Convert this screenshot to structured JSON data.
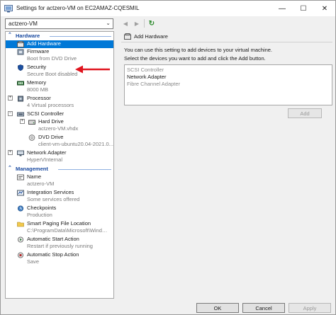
{
  "window": {
    "title": "Settings for actzero-VM on EC2AMAZ-CQESMIL",
    "minimize": "—",
    "maximize": "☐",
    "close": "✕"
  },
  "toolbar": {
    "vm_selected": "actzero-VM",
    "back_glyph": "◀",
    "forward_glyph": "▶",
    "refresh_glyph": "↻"
  },
  "tree": {
    "hardware_header": "Hardware",
    "management_header": "Management",
    "hardware": [
      {
        "label": "Add Hardware",
        "sub": "",
        "icon": "add-hardware-icon",
        "selected": true
      },
      {
        "label": "Firmware",
        "sub": "Boot from DVD Drive",
        "icon": "firmware-icon"
      },
      {
        "label": "Security",
        "sub": "Secure Boot disabled",
        "icon": "shield-icon"
      },
      {
        "label": "Memory",
        "sub": "8000 MB",
        "icon": "memory-icon"
      },
      {
        "label": "Processor",
        "sub": "4 Virtual processors",
        "icon": "processor-icon"
      },
      {
        "label": "SCSI Controller",
        "sub": "",
        "icon": "scsi-controller-icon"
      },
      {
        "label": "Hard Drive",
        "sub": "actzero-VM.vhdx",
        "icon": "hard-drive-icon"
      },
      {
        "label": "DVD Drive",
        "sub": "client-vm-ubuntu20.04-2021.0...",
        "icon": "dvd-drive-icon"
      },
      {
        "label": "Network Adapter",
        "sub": "HyperVInternal",
        "icon": "network-adapter-icon"
      }
    ],
    "management": [
      {
        "label": "Name",
        "sub": "actzero-VM",
        "icon": "name-icon"
      },
      {
        "label": "Integration Services",
        "sub": "Some services offered",
        "icon": "integration-services-icon"
      },
      {
        "label": "Checkpoints",
        "sub": "Production",
        "icon": "checkpoints-icon"
      },
      {
        "label": "Smart Paging File Location",
        "sub": "C:\\ProgramData\\Microsoft\\Windo...",
        "icon": "smart-paging-icon"
      },
      {
        "label": "Automatic Start Action",
        "sub": "Restart if previously running",
        "icon": "auto-start-icon"
      },
      {
        "label": "Automatic Stop Action",
        "sub": "Save",
        "icon": "auto-stop-icon"
      }
    ]
  },
  "panel": {
    "heading": "Add Hardware",
    "line1": "You can use this setting to add devices to your virtual machine.",
    "line2": "Select the devices you want to add and click the Add button.",
    "devices": [
      {
        "label": "SCSI Controller",
        "muted": true
      },
      {
        "label": "Network Adapter",
        "muted": false
      },
      {
        "label": "Fibre Channel Adapter",
        "muted": true
      }
    ],
    "add_button": "Add"
  },
  "footer": {
    "ok": "OK",
    "cancel": "Cancel",
    "apply": "Apply"
  },
  "colors": {
    "selection": "#0078d7",
    "section_header": "#1a4aa0",
    "annotation_arrow": "#e0141e"
  }
}
